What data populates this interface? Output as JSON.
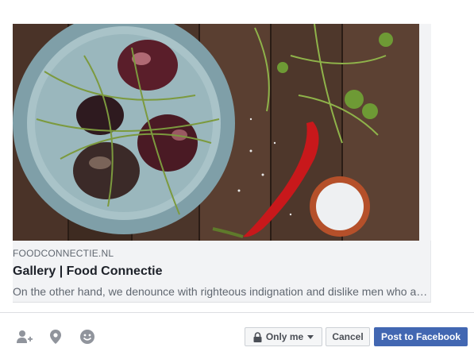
{
  "link_preview": {
    "image_alt": "Photo of beets with thyme in a bowl, a red chili pepper, dill and a dish of salt on a wooden table",
    "domain": "FOODCONNECTIE.NL",
    "title": "Gallery | Food Connectie",
    "description": "On the other hand, we denounce with righteous indignation and dislike men who are so beguiled and demoralized by the charms of pleasure of the moment"
  },
  "toolbar": {
    "icons": [
      "tag-friends-icon",
      "location-icon",
      "feeling-icon"
    ],
    "privacy_label": "Only me",
    "cancel_label": "Cancel",
    "post_label": "Post to Facebook"
  },
  "colors": {
    "primary_button": "#4267b2",
    "secondary_button": "#f5f6f7",
    "muted_text": "#606770",
    "icon_gray": "#90949c"
  }
}
